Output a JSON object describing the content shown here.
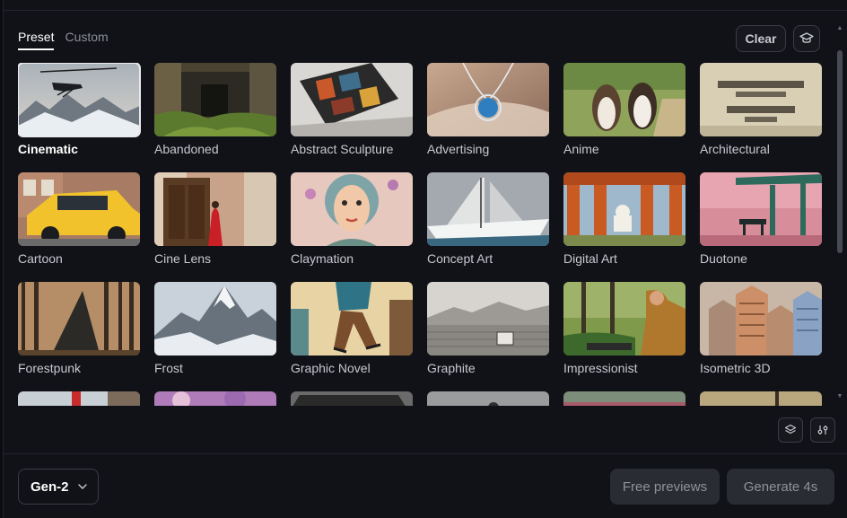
{
  "tabs": [
    {
      "label": "Preset",
      "active": true
    },
    {
      "label": "Custom",
      "active": false
    }
  ],
  "toolbar": {
    "clear_label": "Clear",
    "tutorial_icon": "graduation-cap-icon"
  },
  "presets": [
    {
      "label": "Cinematic",
      "selected": true
    },
    {
      "label": "Abandoned",
      "selected": false
    },
    {
      "label": "Abstract Sculpture",
      "selected": false
    },
    {
      "label": "Advertising",
      "selected": false
    },
    {
      "label": "Anime",
      "selected": false
    },
    {
      "label": "Architectural",
      "selected": false
    },
    {
      "label": "Cartoon",
      "selected": false
    },
    {
      "label": "Cine Lens",
      "selected": false
    },
    {
      "label": "Claymation",
      "selected": false
    },
    {
      "label": "Concept Art",
      "selected": false
    },
    {
      "label": "Digital Art",
      "selected": false
    },
    {
      "label": "Duotone",
      "selected": false
    },
    {
      "label": "Forestpunk",
      "selected": false
    },
    {
      "label": "Frost",
      "selected": false
    },
    {
      "label": "Graphic Novel",
      "selected": false
    },
    {
      "label": "Graphite",
      "selected": false
    },
    {
      "label": "Impressionist",
      "selected": false
    },
    {
      "label": "Isometric 3D",
      "selected": false
    }
  ],
  "tools": {
    "layers_icon": "layers-icon",
    "adjust_icon": "sliders-icon"
  },
  "footer": {
    "model_value": "Gen-2",
    "free_previews_label": "Free previews",
    "generate_label": "Generate 4s"
  }
}
